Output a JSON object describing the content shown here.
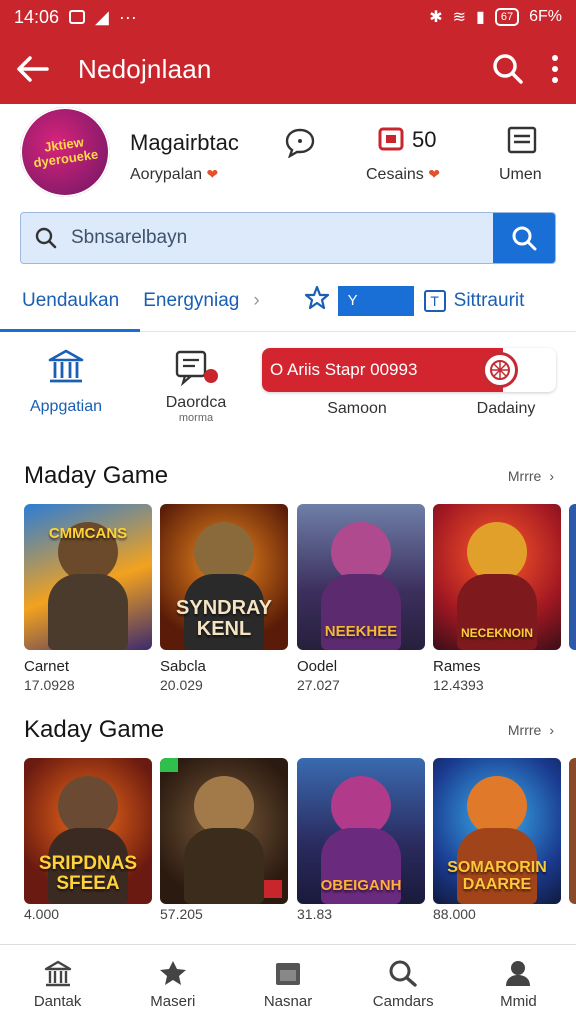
{
  "status_bar": {
    "time": "14:06",
    "battery_text": "67",
    "battery_pct": "6F%"
  },
  "app_bar": {
    "title": "Nedojnlaan",
    "icons": [
      "back-arrow-icon",
      "search-icon",
      "more-vert-icon"
    ]
  },
  "profile": {
    "avatar_text": "Jktiew dyeroueke",
    "name": "Magairbtac",
    "subtitle": "Aorypalan",
    "stat_count": "50",
    "stat_label": "Cesains",
    "right_label": "Umen"
  },
  "search": {
    "placeholder": "Sbnsarelbayn"
  },
  "tabs": {
    "tab1": "Uendaukan",
    "tab2": "Energyniag",
    "chevron": "›",
    "y_label": "Y",
    "box_glyph": "T",
    "tab4": "Sittraurit"
  },
  "actions": {
    "item1": "Appgatian",
    "item2_line1": "Daordca",
    "item2_line2": "morma",
    "promo_text": "O Ariis Stapr 00993",
    "item3": "Samoon",
    "item4": "Dadainy"
  },
  "section1": {
    "title": "Maday Game",
    "more": "Mrrre",
    "cards": [
      {
        "art": "CMMCANS",
        "name": "Carnet",
        "num": "17.0928"
      },
      {
        "art": "SYNDRAY KENL",
        "name": "Sabcla",
        "num": "20.029"
      },
      {
        "art": "NEEKHEE",
        "name": "Oodel",
        "num": "27.027"
      },
      {
        "art": "NECEKNOIN",
        "name": "Rames",
        "num": "12.4393"
      }
    ]
  },
  "section2": {
    "title": "Kaday Game",
    "more": "Mrrre",
    "cards": [
      {
        "art": "SRIPDNAS SFEEA",
        "name": "",
        "num": "4.000"
      },
      {
        "art": "",
        "name": "",
        "num": "57.205"
      },
      {
        "art": "OBEIGANH",
        "name": "",
        "num": "31.83"
      },
      {
        "art": "SOMARORIN DAARRE",
        "name": "",
        "num": "88.000"
      }
    ]
  },
  "bottom_nav": {
    "items": [
      {
        "label": "Dantak",
        "icon": "home-icon"
      },
      {
        "label": "Maseri",
        "icon": "star-badge-icon"
      },
      {
        "label": "Nasnar",
        "icon": "calendar-icon"
      },
      {
        "label": "Camdars",
        "icon": "search-icon"
      },
      {
        "label": "Mmid",
        "icon": "person-icon"
      }
    ]
  },
  "colors": {
    "primary_red": "#c9252c",
    "accent_blue": "#1a6fd6",
    "search_bg": "#dceafb"
  }
}
